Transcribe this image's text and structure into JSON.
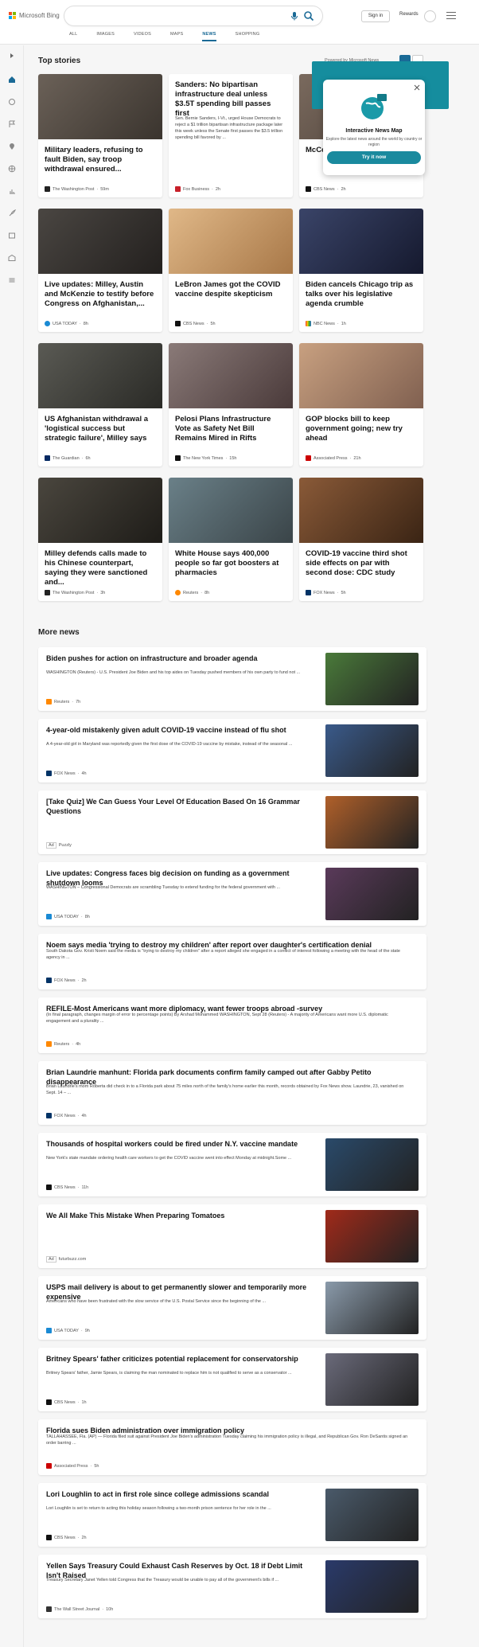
{
  "header": {
    "brand": "Microsoft Bing",
    "signin": "Sign in",
    "rewards": "Rewards"
  },
  "nav": [
    {
      "label": "ALL"
    },
    {
      "label": "IMAGES"
    },
    {
      "label": "VIDEOS"
    },
    {
      "label": "MAPS"
    },
    {
      "label": "NEWS",
      "active": true
    },
    {
      "label": "SHOPPING"
    }
  ],
  "top_stories": {
    "title": "Top stories",
    "powered": "Powered by Microsoft News"
  },
  "popup": {
    "title": "Interactive News Map",
    "desc": "Explore the latest news around the world by country or region",
    "button": "Try it now"
  },
  "cards": [
    {
      "title": "Military leaders, refusing to fault Biden, say troop withdrawal ensured...",
      "source": "The Washington Post",
      "time": "59m",
      "color": "#5a5048"
    },
    {
      "title": "Sanders: No bipartisan infrastructure deal unless $3.5T spending bill passes first",
      "desc": "Sen. Bernie Sanders, I-Vt., urged House Democrats to reject a $1 trillion bipartisan infrastructure package later this week unless the Senate first passes the $3.5 trillion spending bill favored by ...",
      "source": "Fox Business",
      "time": "2h"
    },
    {
      "title": "McCo lates ceilin",
      "source": "CBS News",
      "time": "2h",
      "color": "#6a5a50"
    },
    {
      "title": "Live updates: Milley, Austin and McKenzie to testify before Congress on Afghanistan,...",
      "source": "USA TODAY",
      "time": "8h",
      "color": "#3d3a38"
    },
    {
      "title": "LeBron James got the COVID vaccine despite skepticism",
      "source": "CBS News",
      "time": "5h",
      "color": "#c8a070"
    },
    {
      "title": "Biden cancels Chicago trip as talks over his legislative agenda crumble",
      "source": "NBC News",
      "time": "1h",
      "color": "#2c3350"
    },
    {
      "title": "US Afghanistan withdrawal a 'logistical success but strategic failure', Milley says",
      "source": "The Guardian",
      "time": "6h",
      "color": "#4a4a46"
    },
    {
      "title": "Pelosi Plans Infrastructure Vote as Safety Net Bill Remains Mired in Rifts",
      "source": "The New York Times",
      "time": "15h",
      "color": "#7a6a68"
    },
    {
      "title": "GOP blocks bill to keep government going; new try ahead",
      "source": "Associated Press",
      "time": "21h",
      "color": "#b08a70"
    },
    {
      "title": "Milley defends calls made to his Chinese counterpart, saying they were sanctioned and...",
      "source": "The Washington Post",
      "time": "3h",
      "color": "#3a3630"
    },
    {
      "title": "White House says 400,000 people so far got boosters at pharmacies",
      "source": "Reuters",
      "time": "8h",
      "color": "#5a6a70"
    },
    {
      "title": "COVID-19 vaccine third shot side effects on par with second dose: CDC study",
      "source": "FOX News",
      "time": "5h",
      "color": "#6a4a30"
    }
  ],
  "more_news": {
    "title": "More news"
  },
  "news": [
    {
      "title": "Biden pushes for action on infrastructure and broader agenda",
      "desc": "WASHINGTON (Reuters) - U.S. President Joe Biden and his top aides on Tuesday pushed members of his own party to fund not ...",
      "source": "Reuters",
      "time": "7h",
      "color": "#4a7a3a"
    },
    {
      "title": "4-year-old mistakenly given adult COVID-19 vaccine instead of flu shot",
      "desc": "A 4-year-old girl in Maryland was reportedly given the first dose of the COVID-19 vaccine by mistake, instead of the seasonal ...",
      "source": "FOX News",
      "time": "4h",
      "color": "#3a5a8a"
    },
    {
      "title": "[Take Quiz] We Can Guess Your Level Of Education Based On 16 Grammar Questions",
      "ad": "Ad",
      "source": "Puzzly",
      "time": "",
      "color": "#b0602a"
    },
    {
      "title": "Live updates: Congress faces big decision on funding as a government shutdown looms",
      "desc": "WASHINGTON – Congressional Democrats are scrambling Tuesday to extend funding for the federal government with ...",
      "source": "USA TODAY",
      "time": "8h",
      "color": "#5a3a5a"
    },
    {
      "title": "Noem says media 'trying to destroy my children' after report over daughter's certification denial",
      "desc": "South Dakota Gov. Kristi Noem said the media is \"trying to destroy my children\" after a report alleged she engaged in a conflict of interest following a meeting with the head of the state agency in ...",
      "source": "FOX News",
      "time": "2h"
    },
    {
      "title": "REFILE-Most Americans want more diplomacy, want fewer troops abroad -survey",
      "desc": "(In final paragraph, changes margin of error to percentage points) By Arshad Mohammed WASHINGTON, Sept 28 (Reuters) - A majority of Americans want more U.S. diplomatic engagement and a plurality ...",
      "source": "Reuters",
      "time": "4h"
    },
    {
      "title": "Brian Laundrie manhunt: Florida park documents confirm family camped out after Gabby Petito disappearance",
      "desc": "Brian Laundrie's mom Roberta did check in to a Florida park about 75 miles north of the family's home earlier this month, records obtained by Fox News show. Laundrie, 23, vanished on Sept. 14 – ...",
      "source": "FOX News",
      "time": "4h"
    },
    {
      "title": "Thousands of hospital workers could be fired under N.Y. vaccine mandate",
      "desc": "New York's state mandate ordering health care workers to get the COVID vaccine went into effect Monday at midnight.Some ...",
      "source": "CBS News",
      "time": "11h",
      "color": "#2a4a6a"
    },
    {
      "title": "We All Make This Mistake When Preparing Tomatoes",
      "ad": "Ad",
      "source": "futurbuzz.com",
      "time": "",
      "color": "#a02a1a"
    },
    {
      "title": "USPS mail delivery is about to get permanently slower and temporarily more expensive",
      "desc": "Americans who have been frustrated with the slow service of the U.S. Postal Service since the beginning of the ...",
      "source": "USA TODAY",
      "time": "9h",
      "color": "#8a9aaa"
    },
    {
      "title": "Britney Spears' father criticizes potential replacement for conservatorship",
      "desc": "Britney Spears' father, Jamie Spears, is claiming the man nominated to replace him is not qualified to serve as a conservator ...",
      "source": "CBS News",
      "time": "1h",
      "color": "#6a6a7a"
    },
    {
      "title": "Florida sues Biden administration over immigration policy",
      "desc": "TALLAHASSEE, Fla. (AP) — Florida filed suit against President Joe Biden's administration Tuesday claiming his immigration policy is illegal, and Republican Gov. Ron DeSantis signed an order barring ...",
      "source": "Associated Press",
      "time": "5h"
    },
    {
      "title": "Lori Loughlin to act in first role since college admissions scandal",
      "desc": "Lori Loughlin is set to return to acting this holiday season following a two-month prison sentence for her role in the ...",
      "source": "CBS News",
      "time": "2h",
      "color": "#4a5a6a"
    },
    {
      "title": "Yellen Says Treasury Could Exhaust Cash Reserves by Oct. 18 if Debt Limit Isn't Raised",
      "desc": "Treasury Secretary Janet Yellen told Congress that the Treasury would be unable to pay all of the government's bills if ...",
      "source": "The Wall Street Journal",
      "time": "10h",
      "color": "#2a3a6a"
    }
  ],
  "colors": {
    "accent": "#1a6a96",
    "popup": "#158d9e"
  }
}
